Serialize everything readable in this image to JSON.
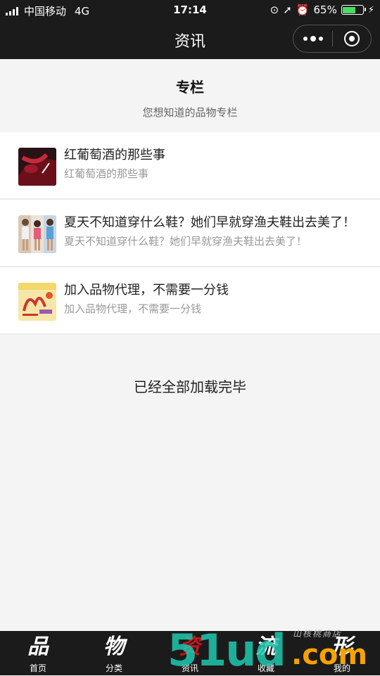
{
  "status_bar": {
    "carrier": "中国移动",
    "network": "4G",
    "time": "17:14",
    "battery_percent": "65%",
    "battery_level": 0.65
  },
  "nav": {
    "title": "资讯"
  },
  "column": {
    "title": "专栏",
    "subtitle": "您想知道的品物专栏"
  },
  "articles": [
    {
      "title": "红葡萄酒的那些事",
      "summary": "红葡萄酒的那些事",
      "thumb": "red-wine-image"
    },
    {
      "title": "夏天不知道穿什么鞋？她们早就穿渔夫鞋出去美了！",
      "summary": "夏天不知道穿什么鞋？她们早就穿渔夫鞋出去美了！",
      "thumb": "fashion-photo-image"
    },
    {
      "title": "加入品物代理，不需要一分钱",
      "summary": "加入品物代理，不需要一分钱",
      "thumb": "agent-poster-image"
    }
  ],
  "list_end_text": "已经全部加载完毕",
  "tabs": [
    {
      "glyph": "品",
      "label": "首页"
    },
    {
      "glyph": "物",
      "label": "分类"
    },
    {
      "glyph": "资",
      "label": "资讯"
    },
    {
      "glyph": "流",
      "label": "收藏"
    },
    {
      "glyph": "形",
      "label": "我的"
    }
  ],
  "watermark": {
    "main": "51ud",
    "suffix": ".com",
    "tagline": "山核桃商店"
  },
  "colors": {
    "bar_background": "#1b1b1b",
    "page_background": "#f4f4f4",
    "battery_green": "#4cd964",
    "active_tab": "#c8161d"
  }
}
